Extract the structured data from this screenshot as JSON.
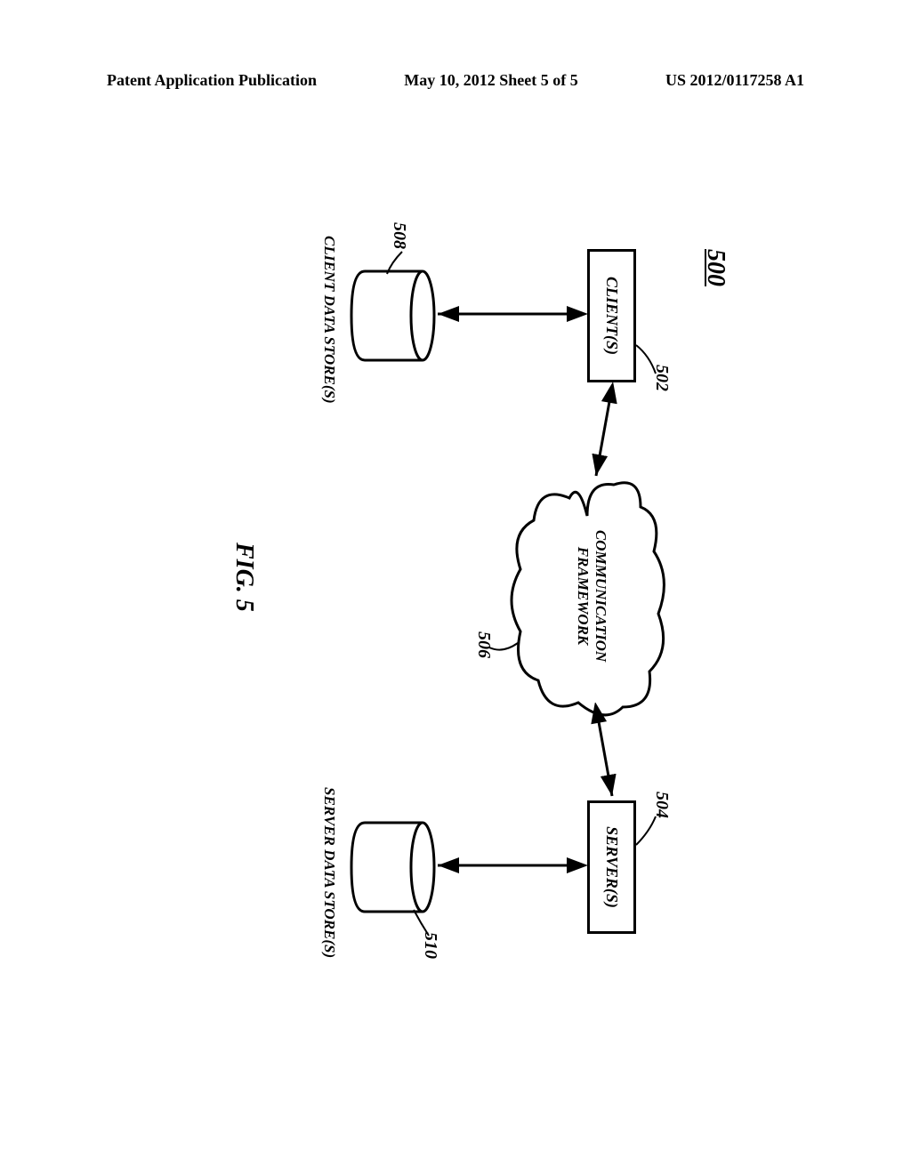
{
  "header": {
    "left": "Patent Application Publication",
    "center": "May 10, 2012  Sheet 5 of 5",
    "right": "US 2012/0117258 A1"
  },
  "figure_number": "500",
  "client_label": "CLIENT(S)",
  "server_label": "SERVER(S)",
  "cloud_line1": "COMMUNICATION",
  "cloud_line2": "FRAMEWORK",
  "client_datastore_label": "CLIENT DATA STORE(S)",
  "server_datastore_label": "SERVER DATA STORE(S)",
  "ref_502": "502",
  "ref_504": "504",
  "ref_506": "506",
  "ref_508": "508",
  "ref_510": "510",
  "figure_caption": "FIG. 5"
}
